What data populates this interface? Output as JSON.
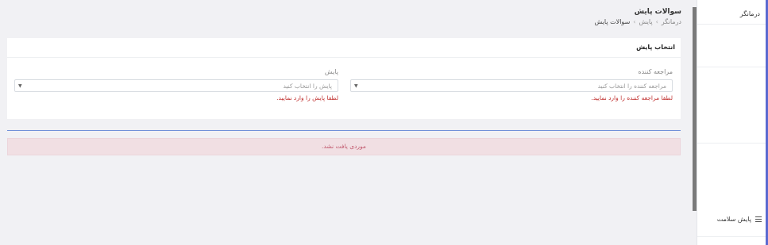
{
  "header": {
    "title": "سوالات پایش",
    "breadcrumb": [
      "درمانگر",
      "پایش",
      "سوالات پایش"
    ]
  },
  "card": {
    "title": "انتخاب پایش",
    "fields": [
      {
        "label": "مراجعه کننده",
        "placeholder": "مراجعه کننده را انتخاب کنید",
        "error": "لطفا مراجعه کننده را وارد نمایید."
      },
      {
        "label": "پایش",
        "placeholder": "پایش را انتخاب کنید",
        "error": "لطفا پایش را وارد نمایید."
      }
    ]
  },
  "alert": {
    "text": "موردی یافت نشد."
  },
  "sidebar": {
    "brand": "درمانگر",
    "items": [
      {
        "label": "پایش سلامت",
        "icon": "list-icon"
      }
    ]
  },
  "colors": {
    "accent": "#5b6ad0",
    "error": "#c0302f",
    "alert_bg": "#f1dfe3",
    "divider_blue": "#6f8fd8"
  }
}
